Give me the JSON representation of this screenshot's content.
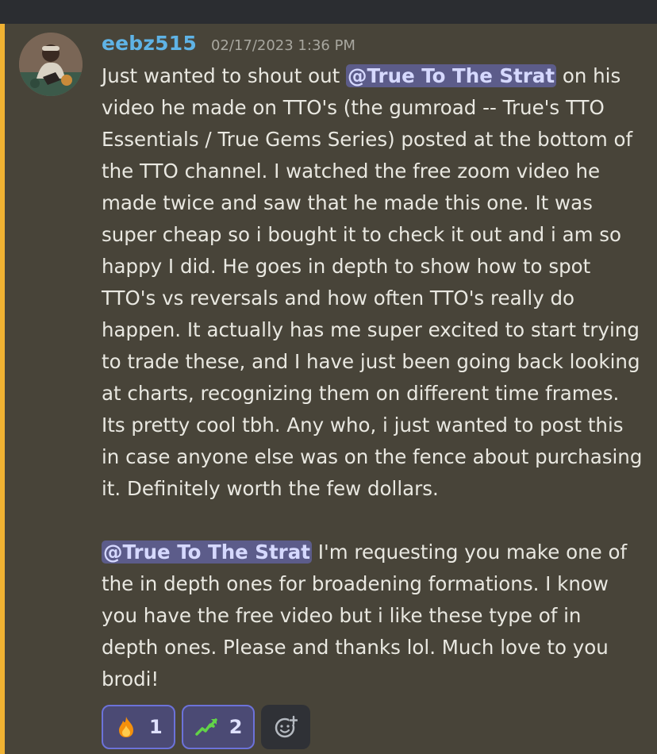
{
  "message": {
    "username": "eebz515",
    "timestamp": "02/17/2023 1:36 PM",
    "paragraph1": {
      "mention": "@True To The Strat",
      "text": "on his video he made on TTO's (the gumroad -- True's TTO Essentials / True Gems Series) posted at the bottom of the TTO channel. I watched the free zoom video he made twice and saw that he made this one. It was super cheap so i bought it to check it out and i am so happy I did. He goes in depth to show how to spot TTO's vs reversals and how often TTO's really do happen. It actually has me super excited to start trying to trade these, and I have just been going back looking at charts, recognizing them on different time frames. Its pretty cool tbh. Any who, i just wanted to post this in case anyone else was on the fence about purchasing it. Definitely worth the few dollars.",
      "prefix": "Just wanted to shout out"
    },
    "paragraph2": {
      "mention": "@True To The Strat",
      "text": "I'm requesting you make one of the in depth ones for broadening formations. I know you have the free video but i like these type of in depth ones. Please and thanks lol. Much love to you brodi!"
    }
  },
  "reactions": [
    {
      "icon": "fire-emoji-icon",
      "count": "1"
    },
    {
      "icon": "chart-up-emoji-icon",
      "count": "2"
    }
  ],
  "add_reaction_icon": "add-reaction-icon",
  "colors": {
    "username": "#5fb3e6",
    "highlight_bar": "#f0b232",
    "mention_bg": "#5c5c8a",
    "reaction_border": "#6c72d9"
  }
}
